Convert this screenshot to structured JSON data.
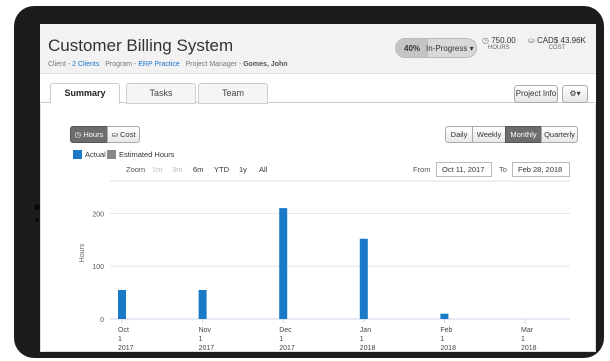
{
  "header": {
    "title": "Customer Billing System",
    "client_prefix": "Client - ",
    "client_link": "2 Clients",
    "program_prefix": "Program - ",
    "program_link": "ERP Practice",
    "pm_prefix": "Project Manager - ",
    "pm_name": "Gomes, John",
    "progress_pct": "40%",
    "progress_fraction": 0.4,
    "status": "In-Progress",
    "hours_value": "750.00",
    "hours_label": "HOURS",
    "cost_value": "CAD$ 43.96K",
    "cost_label": "COST"
  },
  "tabs": [
    "Summary",
    "Tasks",
    "Team"
  ],
  "toolbar": {
    "project_info": "Project Info",
    "settings_caret": "▾"
  },
  "toggles": {
    "hours": "Hours",
    "cost": "Cost"
  },
  "periods": [
    "Daily",
    "Weekly",
    "Monthly",
    "Quarterly"
  ],
  "active_period": "Monthly",
  "legend": {
    "actual": "Actual",
    "estimated": "Estimated Hours"
  },
  "zoom": {
    "label": "Zoom",
    "options": [
      "1m",
      "3m",
      "6m",
      "YTD",
      "1y",
      "All"
    ]
  },
  "range": {
    "from_label": "From",
    "from": "Oct 11, 2017",
    "to_label": "To",
    "to": "Feb 28, 2018"
  },
  "colors": {
    "actual": "#1a7ac8",
    "estimated": "#888888"
  },
  "chart_data": {
    "type": "bar",
    "ylabel": "Hours",
    "ylim": [
      0,
      250
    ],
    "yticks": [
      0,
      100,
      200
    ],
    "categories": [
      "Oct 1 2017",
      "Nov 1 2017",
      "Dec 1 2017",
      "Jan 1 2018",
      "Feb 1 2018",
      "Mar 1 2018"
    ],
    "tick_lines": [
      [
        "Oct",
        "1",
        "2017"
      ],
      [
        "Nov",
        "1",
        "2017"
      ],
      [
        "Dec",
        "1",
        "2017"
      ],
      [
        "Jan",
        "1",
        "2018"
      ],
      [
        "Feb",
        "1",
        "2018"
      ],
      [
        "Mar",
        "1",
        "2018"
      ]
    ],
    "series": [
      {
        "name": "Actual",
        "values": [
          55,
          55,
          210,
          152,
          10,
          0
        ]
      },
      {
        "name": "Estimated Hours",
        "values": [
          0,
          0,
          0,
          0,
          0,
          0
        ]
      }
    ]
  }
}
